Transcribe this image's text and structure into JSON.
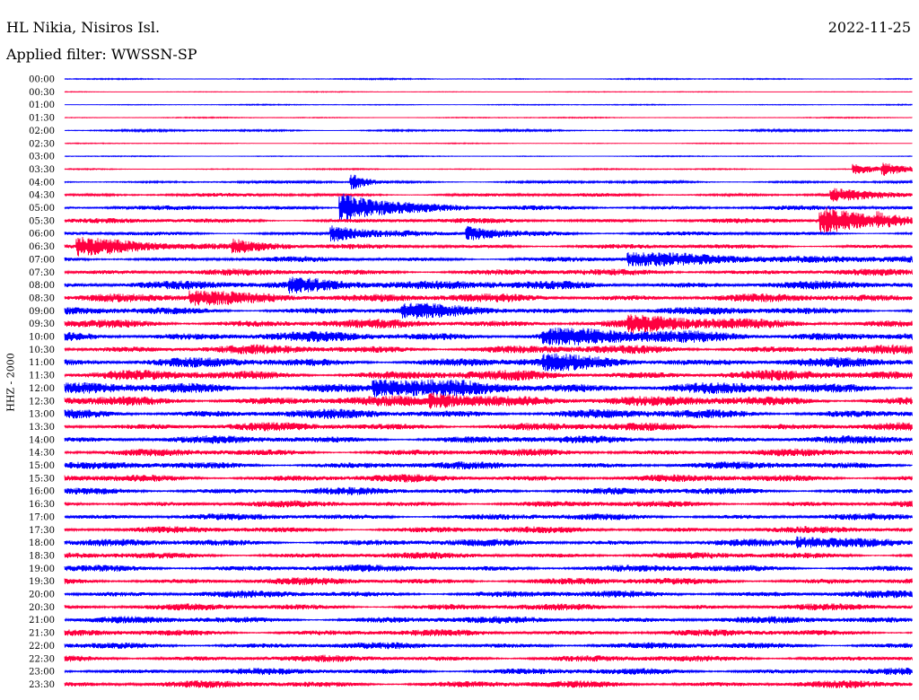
{
  "header": {
    "station": "HL Nikia, Nisiros Isl.",
    "date": "2022-11-25",
    "filter": "Applied filter: WWSSN-SP"
  },
  "chart_data": {
    "type": "line",
    "title": "HL Nikia, Nisiros Isl.",
    "subtitle": "Applied filter: WWSSN-SP",
    "ylabel": "HHZ - 2000",
    "xlabel": "",
    "grid": false,
    "colors": [
      "#0000ff",
      "#ff0040"
    ],
    "row_labels": [
      "00:00",
      "00:30",
      "01:00",
      "01:30",
      "02:00",
      "02:30",
      "03:00",
      "03:30",
      "04:00",
      "04:30",
      "05:00",
      "05:30",
      "06:00",
      "06:30",
      "07:00",
      "07:30",
      "08:00",
      "08:30",
      "09:00",
      "09:30",
      "10:00",
      "10:30",
      "11:00",
      "11:30",
      "12:00",
      "12:30",
      "13:00",
      "13:30",
      "14:00",
      "14:30",
      "15:00",
      "15:30",
      "16:00",
      "16:30",
      "17:00",
      "17:30",
      "18:00",
      "18:30",
      "19:00",
      "19:30",
      "20:00",
      "20:30",
      "21:00",
      "21:30",
      "22:00",
      "22:30",
      "23:00",
      "23:30"
    ],
    "noise_level": [
      0.1,
      0.06,
      0.08,
      0.08,
      0.18,
      0.07,
      0.08,
      0.1,
      0.22,
      0.3,
      0.38,
      0.42,
      0.35,
      0.4,
      0.45,
      0.55,
      0.7,
      0.7,
      0.65,
      0.75,
      0.85,
      0.75,
      0.8,
      0.85,
      0.95,
      0.85,
      0.8,
      0.7,
      0.65,
      0.6,
      0.62,
      0.65,
      0.6,
      0.55,
      0.55,
      0.55,
      0.6,
      0.55,
      0.6,
      0.6,
      0.6,
      0.55,
      0.6,
      0.55,
      0.55,
      0.55,
      0.55,
      0.6
    ],
    "events": [
      {
        "row": 7,
        "minute": 28.0,
        "amp": 0.7,
        "dur": 1.0
      },
      {
        "row": 7,
        "minute": 29.0,
        "amp": 0.7,
        "dur": 1.0
      },
      {
        "row": 8,
        "minute": 10.2,
        "amp": 1.2,
        "dur": 0.5
      },
      {
        "row": 9,
        "minute": 27.2,
        "amp": 0.8,
        "dur": 1.5
      },
      {
        "row": 10,
        "minute": 9.8,
        "amp": 2.2,
        "dur": 1.8
      },
      {
        "row": 11,
        "minute": 26.8,
        "amp": 2.0,
        "dur": 1.6
      },
      {
        "row": 11,
        "minute": 28.8,
        "amp": 0.6,
        "dur": 1.0
      },
      {
        "row": 12,
        "minute": 9.5,
        "amp": 1.2,
        "dur": 1.2
      },
      {
        "row": 12,
        "minute": 14.3,
        "amp": 1.0,
        "dur": 1.5
      },
      {
        "row": 13,
        "minute": 0.5,
        "amp": 1.2,
        "dur": 3.0
      },
      {
        "row": 13,
        "minute": 6.0,
        "amp": 0.8,
        "dur": 1.0
      },
      {
        "row": 14,
        "minute": 20.0,
        "amp": 0.8,
        "dur": 6.0
      },
      {
        "row": 16,
        "minute": 8.0,
        "amp": 0.8,
        "dur": 3.0
      },
      {
        "row": 17,
        "minute": 4.5,
        "amp": 0.8,
        "dur": 3.0
      },
      {
        "row": 18,
        "minute": 12.0,
        "amp": 0.8,
        "dur": 2.0
      },
      {
        "row": 19,
        "minute": 20.0,
        "amp": 0.8,
        "dur": 3.0
      },
      {
        "row": 20,
        "minute": 17.0,
        "amp": 0.8,
        "dur": 4.0
      },
      {
        "row": 22,
        "minute": 17.0,
        "amp": 0.8,
        "dur": 2.0
      },
      {
        "row": 24,
        "minute": 11.0,
        "amp": 0.9,
        "dur": 3.0
      },
      {
        "row": 25,
        "minute": 13.0,
        "amp": 0.8,
        "dur": 3.0
      },
      {
        "row": 36,
        "minute": 26.0,
        "amp": 0.6,
        "dur": 3.0
      }
    ]
  }
}
